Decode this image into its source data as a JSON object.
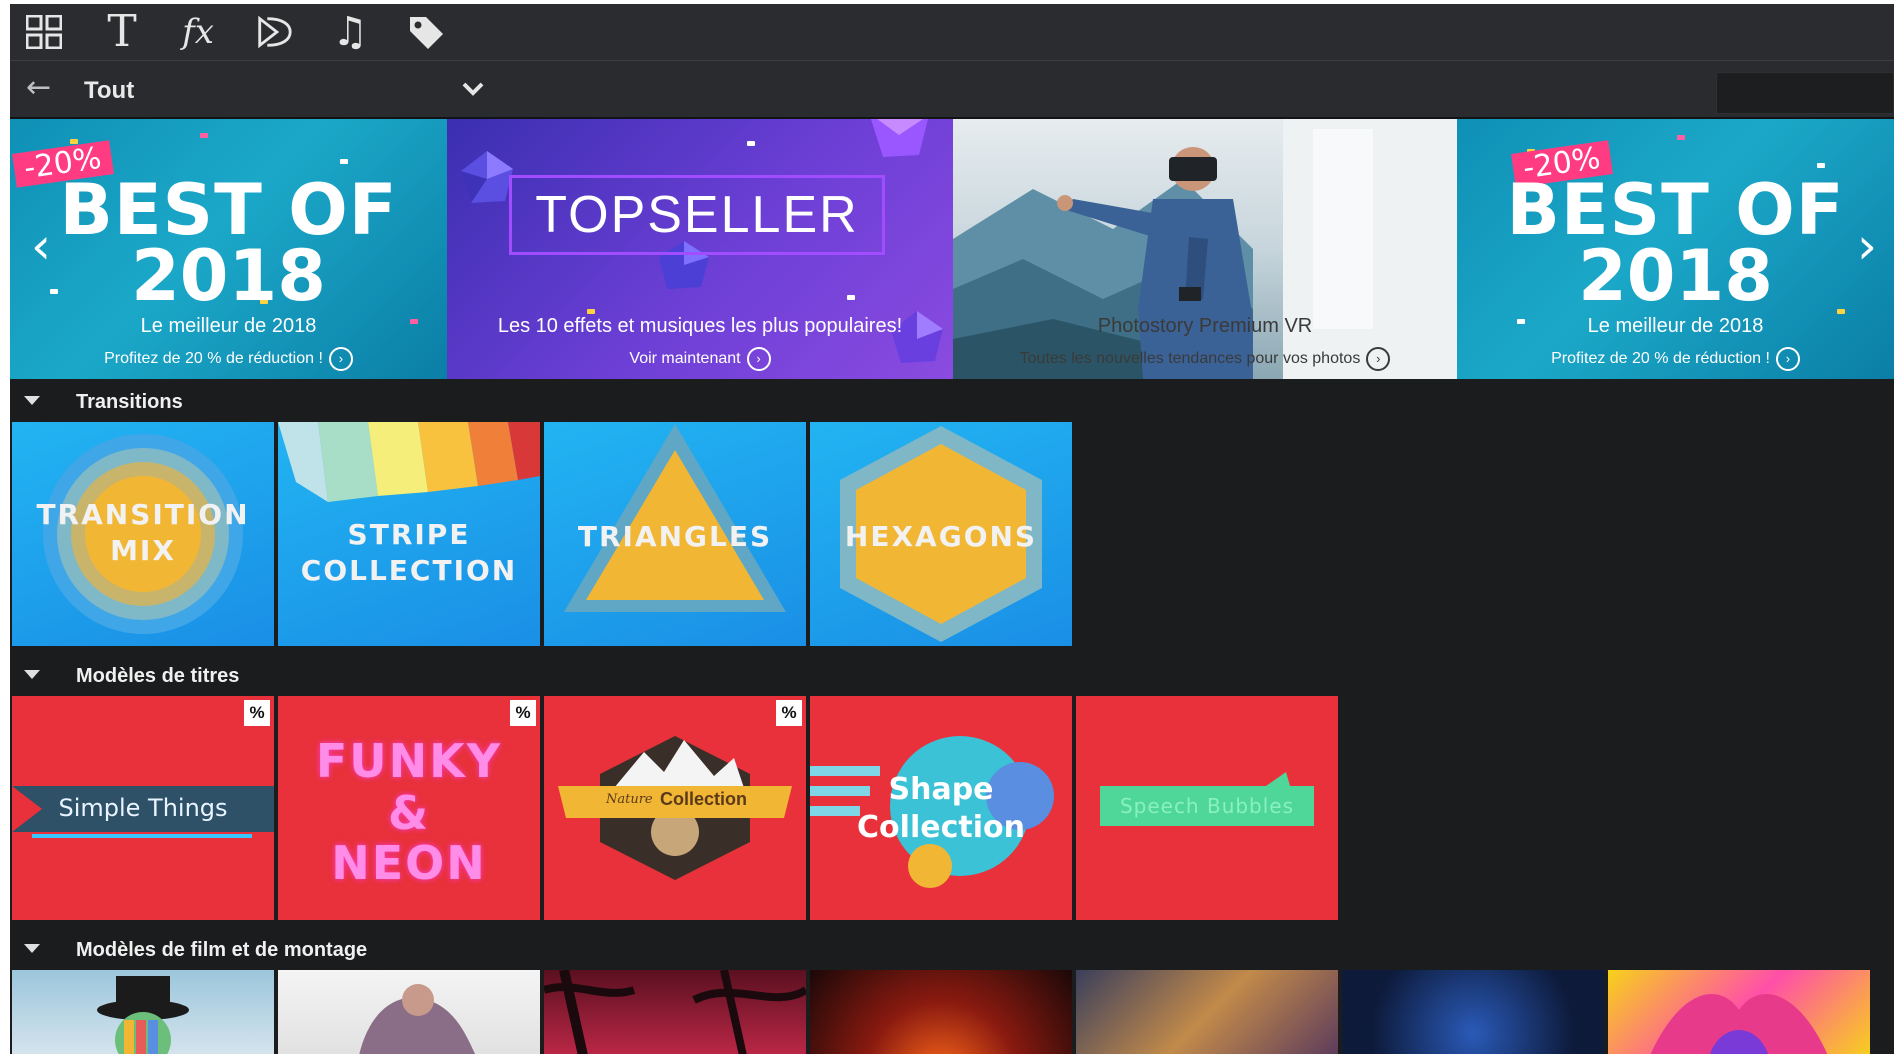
{
  "toolbar": {
    "icons": [
      "grid-icon",
      "text-icon",
      "effects-icon",
      "video-icon",
      "music-icon",
      "tag-icon"
    ],
    "text_glyph": "T",
    "fx_glyph": "fx",
    "music_glyph": "♫"
  },
  "filter": {
    "back_glyph": "←",
    "label": "Tout",
    "search_placeholder": ""
  },
  "banner": {
    "slides": [
      {
        "badge": "-20%",
        "line1": "BEST OF",
        "line2": "2018",
        "subtitle": "Le meilleur de 2018",
        "cta": "Profitez de 20 % de réduction !"
      },
      {
        "title": "TOPSELLER",
        "subtitle": "Les 10 effets et musiques les plus populaires!",
        "cta": "Voir maintenant"
      },
      {
        "subtitle": "Photostory Premium VR",
        "cta": "Toutes les nouvelles tendances pour vos photos"
      },
      {
        "badge": "-20%",
        "line1": "BEST OF",
        "line2": "2018",
        "subtitle": "Le meilleur de 2018",
        "cta": "Profitez de 20 % de réduction !"
      }
    ],
    "prev_glyph": "‹",
    "next_glyph": "›",
    "cta_glyph": "›"
  },
  "sections": [
    {
      "title": "Transitions",
      "tiles": [
        {
          "line1": "TRANSITION",
          "line2": "MIX"
        },
        {
          "line1": "STRIPE",
          "line2": "COLLECTION"
        },
        {
          "line1": "TRIANGLES"
        },
        {
          "line1": "HEXAGONS"
        }
      ]
    },
    {
      "title": "Modèles de titres",
      "tiles": [
        {
          "label": "Simple Things",
          "badge": "%"
        },
        {
          "line1": "FUNKY",
          "line2": "&",
          "line3": "NEON",
          "badge": "%"
        },
        {
          "script": "Nature",
          "label": "Collection",
          "badge": "%"
        },
        {
          "line1": "Shape",
          "line2": "Collection"
        },
        {
          "label": "Speech Bubbles"
        }
      ]
    },
    {
      "title": "Modèles de film et de montage",
      "thumbnails": 7
    }
  ],
  "colors": {
    "app_bg": "#1b1c1e",
    "toolbar_bg": "#2b2c2f",
    "tile_blue": "#1fa3ee",
    "tile_red": "#e8313b",
    "badge_pink": "#ff3c82",
    "topseller_border": "#a24cff"
  }
}
